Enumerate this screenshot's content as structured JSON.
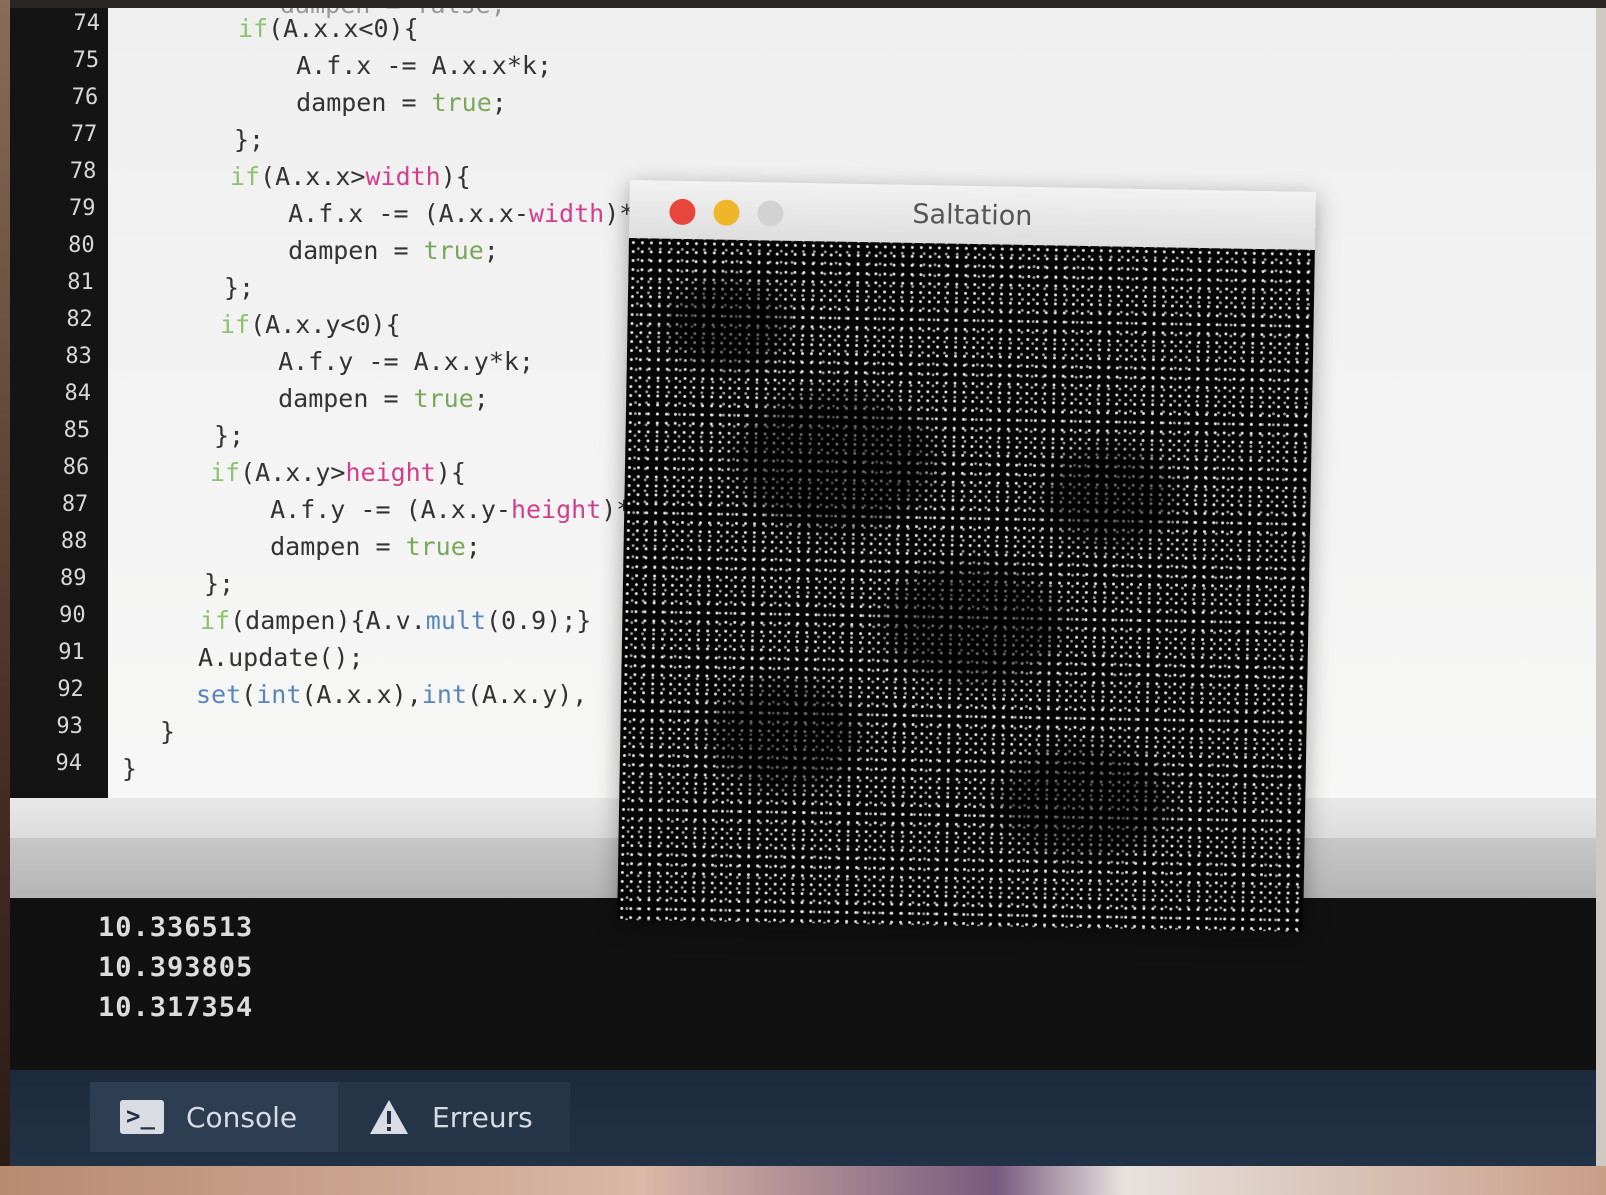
{
  "editor": {
    "lines": [
      {
        "no": "74",
        "html": "<span class=\"kw\">if</span>(A.x.x&lt;0){"
      },
      {
        "no": "75",
        "html": "  A.f.x -= A.x.x*k;"
      },
      {
        "no": "76",
        "html": "  dampen = <span class=\"lit\">true</span>;"
      },
      {
        "no": "77",
        "html": "};"
      },
      {
        "no": "78",
        "html": "<span class=\"kw\">if</span>(A.x.x&gt;<span class=\"var\">width</span>){"
      },
      {
        "no": "79",
        "html": "  A.f.x -= (A.x.x-<span class=\"var\">width</span>)*k"
      },
      {
        "no": "80",
        "html": "  dampen = <span class=\"lit\">true</span>;"
      },
      {
        "no": "81",
        "html": "};"
      },
      {
        "no": "82",
        "html": "<span class=\"kw\">if</span>(A.x.y&lt;0){"
      },
      {
        "no": "83",
        "html": "  A.f.y -= A.x.y*k;"
      },
      {
        "no": "84",
        "html": "  dampen = <span class=\"lit\">true</span>;"
      },
      {
        "no": "85",
        "html": "};"
      },
      {
        "no": "86",
        "html": "<span class=\"kw\">if</span>(A.x.y&gt;<span class=\"var\">height</span>){"
      },
      {
        "no": "87",
        "html": "  A.f.y -= (A.x.y-<span class=\"var\">height</span>)*"
      },
      {
        "no": "88",
        "html": "  dampen = <span class=\"lit\">true</span>;"
      },
      {
        "no": "89",
        "html": "};"
      },
      {
        "no": "90",
        "html": "<span class=\"kw\">if</span>(dampen){A.v.<span class=\"fn\">mult</span>(0.9);}"
      },
      {
        "no": "91",
        "html": "A.update();"
      },
      {
        "no": "92",
        "html": "<span class=\"fn\">set</span>(<span class=\"fn\">int</span>(A.x.x),<span class=\"fn\">int</span>(A.x.y),"
      },
      {
        "no": "93",
        "html": "}"
      },
      {
        "no": "94",
        "html": "}"
      }
    ],
    "partial_top_line": "dampen = false;"
  },
  "console": {
    "lines": [
      "10.336513",
      "10.393805",
      "10.317354"
    ]
  },
  "tabs": {
    "console_label": "Console",
    "errors_label": "Erreurs"
  },
  "sketch_window": {
    "title": "Saltation"
  },
  "colors": {
    "keyword": "#8cc270",
    "variable": "#d0408c",
    "function": "#5b86b8",
    "literal": "#7aa75a",
    "tab_bar": "#223246"
  }
}
